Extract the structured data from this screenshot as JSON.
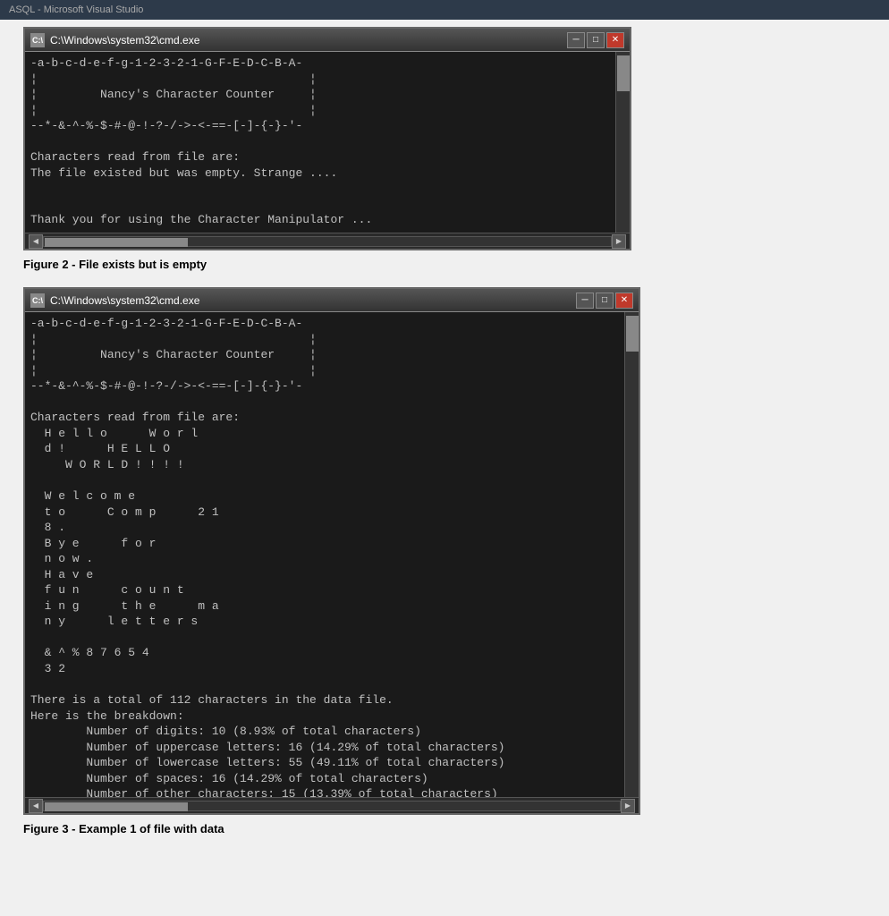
{
  "topbar": {
    "text": "ASQL - Microsoft Visual Studio"
  },
  "figure2": {
    "titlebar": {
      "icon": "C:\\",
      "title": "C:\\Windows\\system32\\cmd.exe",
      "minimize": "─",
      "maximize": "□",
      "close": "✕"
    },
    "console_content": "-a-b-c-d-e-f-g-1-2-3-2-1-G-F-E-D-C-B-A-\n¦                                       ¦\n¦         Nancy's Character Counter     ¦\n¦                                       ¦\n--*-&-^-%-$-#-@-!-?-/->-<-==-[-]-{-}-'-\n\nCharacters read from file are:\nThe file existed but was empty. Strange ....\n\n\nThank you for using the Character Manipulator ...\n",
    "caption": "Figure 2 - File exists but is empty"
  },
  "figure3": {
    "titlebar": {
      "icon": "C:\\",
      "title": "C:\\Windows\\system32\\cmd.exe",
      "minimize": "─",
      "maximize": "□",
      "close": "✕"
    },
    "console_content": "-a-b-c-d-e-f-g-1-2-3-2-1-G-F-E-D-C-B-A-\n¦                                       ¦\n¦         Nancy's Character Counter     ¦\n¦                                       ¦\n--*-&-^-%-$-#-@-!-?-/->-<-==-[-]-{-}-'-\n\nCharacters read from file are:\n  H e l l o      W o r l\n  d !      H E L L O\n     W O R L D ! ! ! !\n\n  W e l c o m e\n  t o      C o m p      2 1\n  8 .\n  B y e      f o r\n  n o w .\n  H a v e\n  f u n      c o u n t\n  i n g      t h e      m a\n  n y      l e t t e r s\n\n  & ^ % 8 7 6 5 4\n  3 2\n\nThere is a total of 112 characters in the data file.\nHere is the breakdown:\n        Number of digits: 10 (8.93% of total characters)\n        Number of uppercase letters: 16 (14.29% of total characters)\n        Number of lowercase letters: 55 (49.11% of total characters)\n        Number of spaces: 16 (14.29% of total characters)\n        Number of other characters: 15 (13.39% of total characters)\n\n\nThank you for usig the Character Manipulator ...\n",
    "caption": "Figure 3 - Example 1 of file with data"
  }
}
